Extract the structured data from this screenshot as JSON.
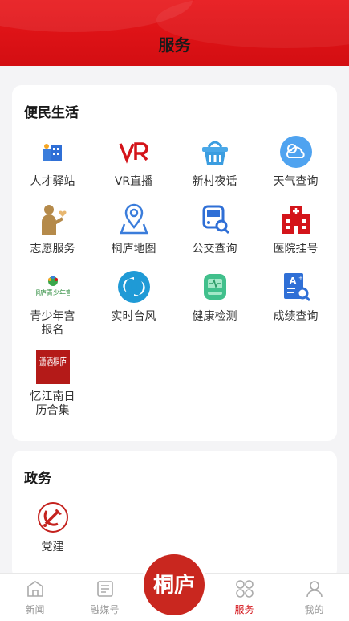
{
  "header": {
    "title": "服务"
  },
  "section_life": {
    "title": "便民生活",
    "items": [
      {
        "label": "人才驿站",
        "icon": "talent-station-icon"
      },
      {
        "label": "VR直播",
        "icon": "vr-live-icon"
      },
      {
        "label": "新村夜话",
        "icon": "village-basket-icon"
      },
      {
        "label": "天气查询",
        "icon": "weather-icon"
      },
      {
        "label": "志愿服务",
        "icon": "volunteer-icon"
      },
      {
        "label": "桐庐地图",
        "icon": "map-icon"
      },
      {
        "label": "公交查询",
        "icon": "bus-icon"
      },
      {
        "label": "医院挂号",
        "icon": "hospital-icon"
      },
      {
        "label": "青少年宫报名",
        "icon": "youth-palace-logo-icon",
        "logo_text": "桐庐青少年宫"
      },
      {
        "label": "实时台风",
        "icon": "typhoon-icon"
      },
      {
        "label": "健康检测",
        "icon": "health-check-icon"
      },
      {
        "label": "成绩查询",
        "icon": "score-query-icon"
      },
      {
        "label": "忆江南日历合集",
        "icon": "calendar-seal-icon",
        "logo_text": "潇洒桐庐"
      }
    ]
  },
  "section_gov": {
    "title": "政务",
    "items": [
      {
        "label": "党建",
        "icon": "party-emblem-icon"
      }
    ]
  },
  "tabbar": {
    "tabs": [
      {
        "label": "新闻",
        "icon": "news-icon"
      },
      {
        "label": "融媒号",
        "icon": "media-icon"
      },
      {
        "label": "服务",
        "icon": "service-icon",
        "active": true
      },
      {
        "label": "我的",
        "icon": "profile-icon"
      }
    ],
    "center_logo_text": "桐庐"
  },
  "colors": {
    "brand_red": "#d4141a",
    "blue": "#3b7ddb",
    "active_tab": "#d4141a",
    "inactive_tab": "#999999"
  }
}
